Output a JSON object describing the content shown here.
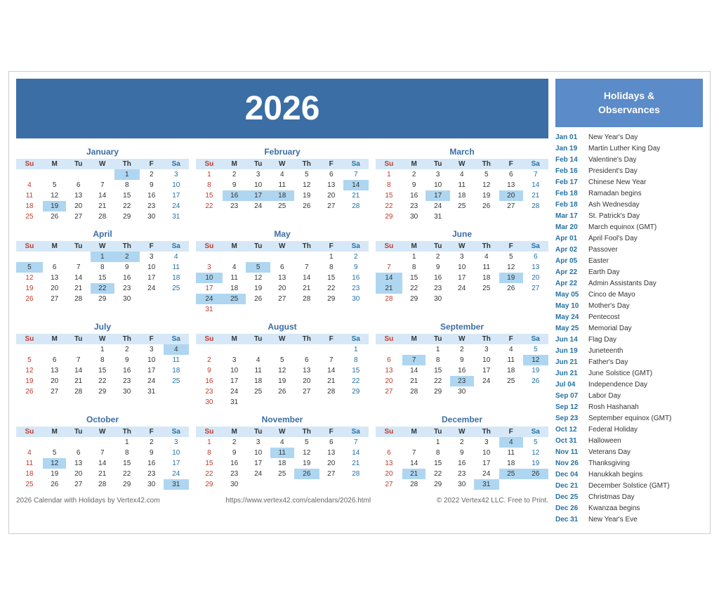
{
  "title": "2026",
  "footer": {
    "left": "2026 Calendar with Holidays by Vertex42.com",
    "center": "https://www.vertex42.com/calendars/2026.html",
    "right": "© 2022 Vertex42 LLC. Free to Print."
  },
  "holidays_header": "Holidays &\nObservances",
  "holidays": [
    {
      "date": "Jan 01",
      "name": "New Year's Day"
    },
    {
      "date": "Jan 19",
      "name": "Martin Luther King Day"
    },
    {
      "date": "Feb 14",
      "name": "Valentine's Day"
    },
    {
      "date": "Feb 16",
      "name": "President's Day"
    },
    {
      "date": "Feb 17",
      "name": "Chinese New Year"
    },
    {
      "date": "Feb 18",
      "name": "Ramadan begins"
    },
    {
      "date": "Feb 18",
      "name": "Ash Wednesday"
    },
    {
      "date": "Mar 17",
      "name": "St. Patrick's Day"
    },
    {
      "date": "Mar 20",
      "name": "March equinox (GMT)"
    },
    {
      "date": "Apr 01",
      "name": "April Fool's Day"
    },
    {
      "date": "Apr 02",
      "name": "Passover"
    },
    {
      "date": "Apr 05",
      "name": "Easter"
    },
    {
      "date": "Apr 22",
      "name": "Earth Day"
    },
    {
      "date": "Apr 22",
      "name": "Admin Assistants Day"
    },
    {
      "date": "May 05",
      "name": "Cinco de Mayo"
    },
    {
      "date": "May 10",
      "name": "Mother's Day"
    },
    {
      "date": "May 24",
      "name": "Pentecost"
    },
    {
      "date": "May 25",
      "name": "Memorial Day"
    },
    {
      "date": "Jun 14",
      "name": "Flag Day"
    },
    {
      "date": "Jun 19",
      "name": "Juneteenth"
    },
    {
      "date": "Jun 21",
      "name": "Father's Day"
    },
    {
      "date": "Jun 21",
      "name": "June Solstice (GMT)"
    },
    {
      "date": "Jul 04",
      "name": "Independence Day"
    },
    {
      "date": "Sep 07",
      "name": "Labor Day"
    },
    {
      "date": "Sep 12",
      "name": "Rosh Hashanah"
    },
    {
      "date": "Sep 23",
      "name": "September equinox (GMT)"
    },
    {
      "date": "Oct 12",
      "name": "Federal Holiday"
    },
    {
      "date": "Oct 31",
      "name": "Halloween"
    },
    {
      "date": "Nov 11",
      "name": "Veterans Day"
    },
    {
      "date": "Nov 26",
      "name": "Thanksgiving"
    },
    {
      "date": "Dec 04",
      "name": "Hanukkah begins"
    },
    {
      "date": "Dec 21",
      "name": "December Solstice (GMT)"
    },
    {
      "date": "Dec 25",
      "name": "Christmas Day"
    },
    {
      "date": "Dec 26",
      "name": "Kwanzaa begins"
    },
    {
      "date": "Dec 31",
      "name": "New Year's Eve"
    }
  ],
  "months": [
    {
      "name": "January",
      "days": [
        [
          "",
          "",
          "",
          "",
          "1",
          "2",
          "3"
        ],
        [
          "4",
          "5",
          "6",
          "7",
          "8",
          "9",
          "10"
        ],
        [
          "11",
          "12",
          "13",
          "14",
          "15",
          "16",
          "17"
        ],
        [
          "18",
          "19",
          "20",
          "21",
          "22",
          "23",
          "24"
        ],
        [
          "25",
          "26",
          "27",
          "28",
          "29",
          "30",
          "31"
        ]
      ],
      "highlighted": [
        "1",
        "19"
      ],
      "today": []
    },
    {
      "name": "February",
      "days": [
        [
          "1",
          "2",
          "3",
          "4",
          "5",
          "6",
          "7"
        ],
        [
          "8",
          "9",
          "10",
          "11",
          "12",
          "13",
          "14"
        ],
        [
          "15",
          "16",
          "17",
          "18",
          "19",
          "20",
          "21"
        ],
        [
          "22",
          "23",
          "24",
          "25",
          "26",
          "27",
          "28"
        ]
      ],
      "highlighted": [
        "14",
        "16",
        "17",
        "18"
      ],
      "today": []
    },
    {
      "name": "March",
      "days": [
        [
          "1",
          "2",
          "3",
          "4",
          "5",
          "6",
          "7"
        ],
        [
          "8",
          "9",
          "10",
          "11",
          "12",
          "13",
          "14"
        ],
        [
          "15",
          "16",
          "17",
          "18",
          "19",
          "20",
          "21"
        ],
        [
          "22",
          "23",
          "24",
          "25",
          "26",
          "27",
          "28"
        ],
        [
          "29",
          "30",
          "31",
          "",
          "",
          "",
          ""
        ]
      ],
      "highlighted": [
        "17",
        "20"
      ],
      "today": []
    },
    {
      "name": "April",
      "days": [
        [
          "",
          "",
          "",
          "1",
          "2",
          "3",
          "4"
        ],
        [
          "5",
          "6",
          "7",
          "8",
          "9",
          "10",
          "11"
        ],
        [
          "12",
          "13",
          "14",
          "15",
          "16",
          "17",
          "18"
        ],
        [
          "19",
          "20",
          "21",
          "22",
          "23",
          "24",
          "25"
        ],
        [
          "26",
          "27",
          "28",
          "29",
          "30",
          "",
          ""
        ]
      ],
      "highlighted": [
        "1",
        "2",
        "5",
        "22"
      ],
      "today": []
    },
    {
      "name": "May",
      "days": [
        [
          "",
          "",
          "",
          "",
          "",
          "1",
          "2"
        ],
        [
          "3",
          "4",
          "5",
          "6",
          "7",
          "8",
          "9"
        ],
        [
          "10",
          "11",
          "12",
          "13",
          "14",
          "15",
          "16"
        ],
        [
          "17",
          "18",
          "19",
          "20",
          "21",
          "22",
          "23"
        ],
        [
          "24",
          "25",
          "26",
          "27",
          "28",
          "29",
          "30"
        ],
        [
          "31",
          "",
          "",
          "",
          "",
          "",
          ""
        ]
      ],
      "highlighted": [
        "5",
        "10",
        "24",
        "25"
      ],
      "today": []
    },
    {
      "name": "June",
      "days": [
        [
          "",
          "1",
          "2",
          "3",
          "4",
          "5",
          "6"
        ],
        [
          "7",
          "8",
          "9",
          "10",
          "11",
          "12",
          "13"
        ],
        [
          "14",
          "15",
          "16",
          "17",
          "18",
          "19",
          "20"
        ],
        [
          "21",
          "22",
          "23",
          "24",
          "25",
          "26",
          "27"
        ],
        [
          "28",
          "29",
          "30",
          "",
          "",
          "",
          ""
        ]
      ],
      "highlighted": [
        "14",
        "19",
        "21"
      ],
      "today": []
    },
    {
      "name": "July",
      "days": [
        [
          "",
          "",
          "",
          "1",
          "2",
          "3",
          "4"
        ],
        [
          "5",
          "6",
          "7",
          "8",
          "9",
          "10",
          "11"
        ],
        [
          "12",
          "13",
          "14",
          "15",
          "16",
          "17",
          "18"
        ],
        [
          "19",
          "20",
          "21",
          "22",
          "23",
          "24",
          "25"
        ],
        [
          "26",
          "27",
          "28",
          "29",
          "30",
          "31",
          ""
        ]
      ],
      "highlighted": [
        "4"
      ],
      "today": []
    },
    {
      "name": "August",
      "days": [
        [
          "",
          "",
          "",
          "",
          "",
          "",
          "1"
        ],
        [
          "2",
          "3",
          "4",
          "5",
          "6",
          "7",
          "8"
        ],
        [
          "9",
          "10",
          "11",
          "12",
          "13",
          "14",
          "15"
        ],
        [
          "16",
          "17",
          "18",
          "19",
          "20",
          "21",
          "22"
        ],
        [
          "23",
          "24",
          "25",
          "26",
          "27",
          "28",
          "29"
        ],
        [
          "30",
          "31",
          "",
          "",
          "",
          "",
          ""
        ]
      ],
      "highlighted": [],
      "today": []
    },
    {
      "name": "September",
      "days": [
        [
          "",
          "",
          "1",
          "2",
          "3",
          "4",
          "5"
        ],
        [
          "6",
          "7",
          "8",
          "9",
          "10",
          "11",
          "12"
        ],
        [
          "13",
          "14",
          "15",
          "16",
          "17",
          "18",
          "19"
        ],
        [
          "20",
          "21",
          "22",
          "23",
          "24",
          "25",
          "26"
        ],
        [
          "27",
          "28",
          "29",
          "30",
          "",
          "",
          ""
        ]
      ],
      "highlighted": [
        "7",
        "12",
        "23"
      ],
      "today": []
    },
    {
      "name": "October",
      "days": [
        [
          "",
          "",
          "",
          "",
          "1",
          "2",
          "3"
        ],
        [
          "4",
          "5",
          "6",
          "7",
          "8",
          "9",
          "10"
        ],
        [
          "11",
          "12",
          "13",
          "14",
          "15",
          "16",
          "17"
        ],
        [
          "18",
          "19",
          "20",
          "21",
          "22",
          "23",
          "24"
        ],
        [
          "25",
          "26",
          "27",
          "28",
          "29",
          "30",
          "31"
        ]
      ],
      "highlighted": [
        "12",
        "31"
      ],
      "today": []
    },
    {
      "name": "November",
      "days": [
        [
          "1",
          "2",
          "3",
          "4",
          "5",
          "6",
          "7"
        ],
        [
          "8",
          "9",
          "10",
          "11",
          "12",
          "13",
          "14"
        ],
        [
          "15",
          "16",
          "17",
          "18",
          "19",
          "20",
          "21"
        ],
        [
          "22",
          "23",
          "24",
          "25",
          "26",
          "27",
          "28"
        ],
        [
          "29",
          "30",
          "",
          "",
          "",
          "",
          ""
        ]
      ],
      "highlighted": [
        "11",
        "26"
      ],
      "today": []
    },
    {
      "name": "December",
      "days": [
        [
          "",
          "",
          "1",
          "2",
          "3",
          "4",
          "5"
        ],
        [
          "6",
          "7",
          "8",
          "9",
          "10",
          "11",
          "12"
        ],
        [
          "13",
          "14",
          "15",
          "16",
          "17",
          "18",
          "19"
        ],
        [
          "20",
          "21",
          "22",
          "23",
          "24",
          "25",
          "26"
        ],
        [
          "27",
          "28",
          "29",
          "30",
          "31",
          "",
          ""
        ]
      ],
      "highlighted": [
        "4",
        "21",
        "25",
        "26",
        "31"
      ],
      "today": []
    }
  ]
}
